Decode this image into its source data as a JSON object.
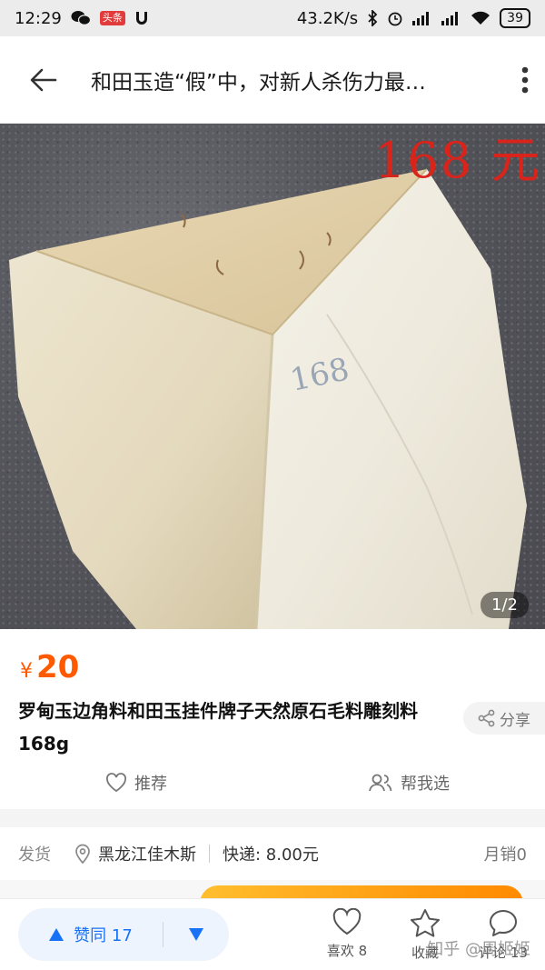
{
  "status_bar": {
    "time": "12:29",
    "toutiao_badge": "头条",
    "network_speed": "43.2K/s",
    "battery": "39"
  },
  "nav": {
    "title": "和田玉造“假”中，对新人杀伤力最…"
  },
  "photo": {
    "price_overlay": "168 元",
    "handwritten_mark": "168",
    "page_indicator": "1/2"
  },
  "product": {
    "currency": "¥",
    "price": "20",
    "title": "罗甸玉边角料和田玉挂件牌子天然原石毛料雕刻料168g",
    "share_label": "分享",
    "recommend_label": "推荐",
    "help_choose_label": "帮我选"
  },
  "shipping": {
    "label": "发货",
    "location": "黑龙江佳木斯",
    "express": "快递: 8.00元",
    "monthly_sales": "月销0"
  },
  "zhihu_bar": {
    "vote_label": "赞同 17",
    "like_label": "喜欢 8",
    "collect_label": "收藏",
    "comment_label": "评论 13",
    "watermark": "知乎 @周姬姬"
  },
  "colors": {
    "price_orange": "#ff5a00",
    "zhihu_blue": "#1772f6",
    "overlay_red": "#d9241b"
  }
}
